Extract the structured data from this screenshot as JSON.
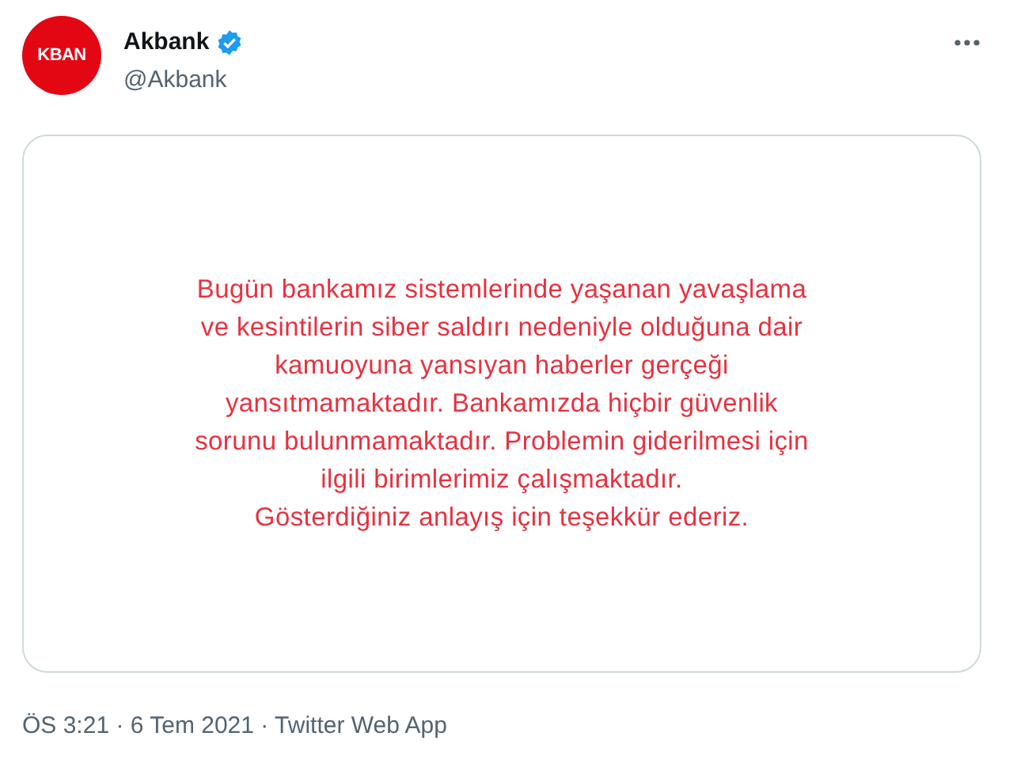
{
  "author": {
    "logo_text": "KBAN",
    "name": "Akbank",
    "verified": true,
    "handle": "@Akbank"
  },
  "image": {
    "lines": [
      "Bugün bankamız sistemlerinde yaşanan yavaşlama",
      "ve kesintilerin siber saldırı nedeniyle olduğuna dair",
      "kamuoyuna yansıyan haberler gerçeği",
      "yansıtmamaktadır. Bankamızda hiçbir güvenlik",
      "sorunu bulunmamaktadır. Problemin giderilmesi için",
      "ilgili birimlerimiz çalışmaktadır.",
      "Gösterdiğiniz anlayış için teşekkür ederiz."
    ]
  },
  "meta": "ÖS 3:21 · 6 Tem 2021 · Twitter Web App"
}
